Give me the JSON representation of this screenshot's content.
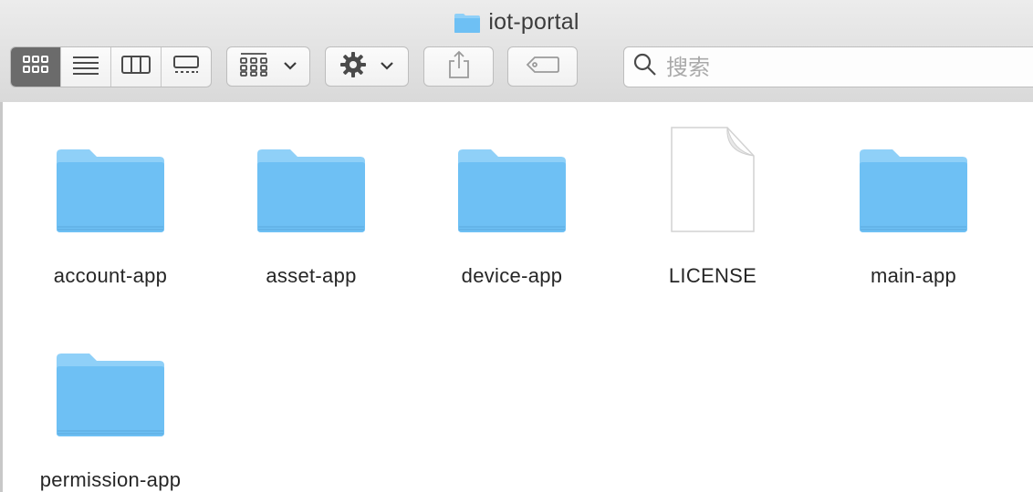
{
  "window": {
    "title": "iot-portal",
    "title_icon": "folder-icon"
  },
  "toolbar": {
    "views": [
      {
        "name": "icon-view",
        "icon": "grid-icon",
        "active": true
      },
      {
        "name": "list-view",
        "icon": "list-icon",
        "active": false
      },
      {
        "name": "column-view",
        "icon": "columns-icon",
        "active": false
      },
      {
        "name": "gallery-view",
        "icon": "gallery-icon",
        "active": false
      }
    ],
    "group_icon": "group-by-icon",
    "action_icon": "gear-icon",
    "share_icon": "share-icon",
    "tag_icon": "tag-icon",
    "search": {
      "placeholder": "搜索",
      "value": ""
    }
  },
  "files": [
    {
      "name": "account-app",
      "kind": "folder"
    },
    {
      "name": "asset-app",
      "kind": "folder"
    },
    {
      "name": "device-app",
      "kind": "folder"
    },
    {
      "name": "LICENSE",
      "kind": "document"
    },
    {
      "name": "main-app",
      "kind": "folder"
    },
    {
      "name": "permission-app",
      "kind": "folder"
    }
  ],
  "colors": {
    "folder_top": "#8fd0f8",
    "folder_body": "#6ec0f4",
    "active_view": "#6b6b6b"
  }
}
